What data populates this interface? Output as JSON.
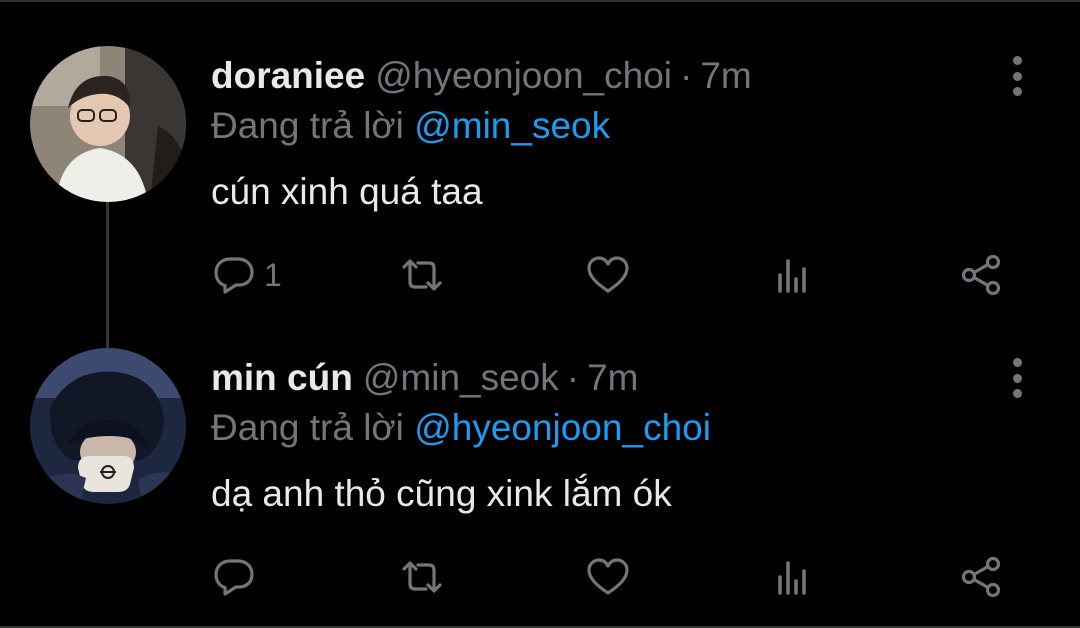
{
  "colors": {
    "background": "#000000",
    "primary_text": "#e7e9ea",
    "secondary_text": "#71767b",
    "mention": "#1d9bf0"
  },
  "tweets": [
    {
      "display_name": "doraniee",
      "handle": "@hyeonjoon_choi",
      "separator": "·",
      "time": "7m",
      "reply_prefix": "Đang trả lời",
      "reply_to": "@min_seok",
      "text": "cún xinh quá taa",
      "reply_count": "1",
      "icons": [
        "reply-icon",
        "retweet-icon",
        "like-icon",
        "views-icon",
        "share-icon",
        "more-icon"
      ]
    },
    {
      "display_name": "min cún",
      "handle": "@min_seok",
      "separator": "·",
      "time": "7m",
      "reply_prefix": "Đang trả lời",
      "reply_to": "@hyeonjoon_choi",
      "text": "dạ anh thỏ cũng xink lắm ók",
      "reply_count": "",
      "icons": [
        "reply-icon",
        "retweet-icon",
        "like-icon",
        "views-icon",
        "share-icon",
        "more-icon"
      ]
    }
  ]
}
